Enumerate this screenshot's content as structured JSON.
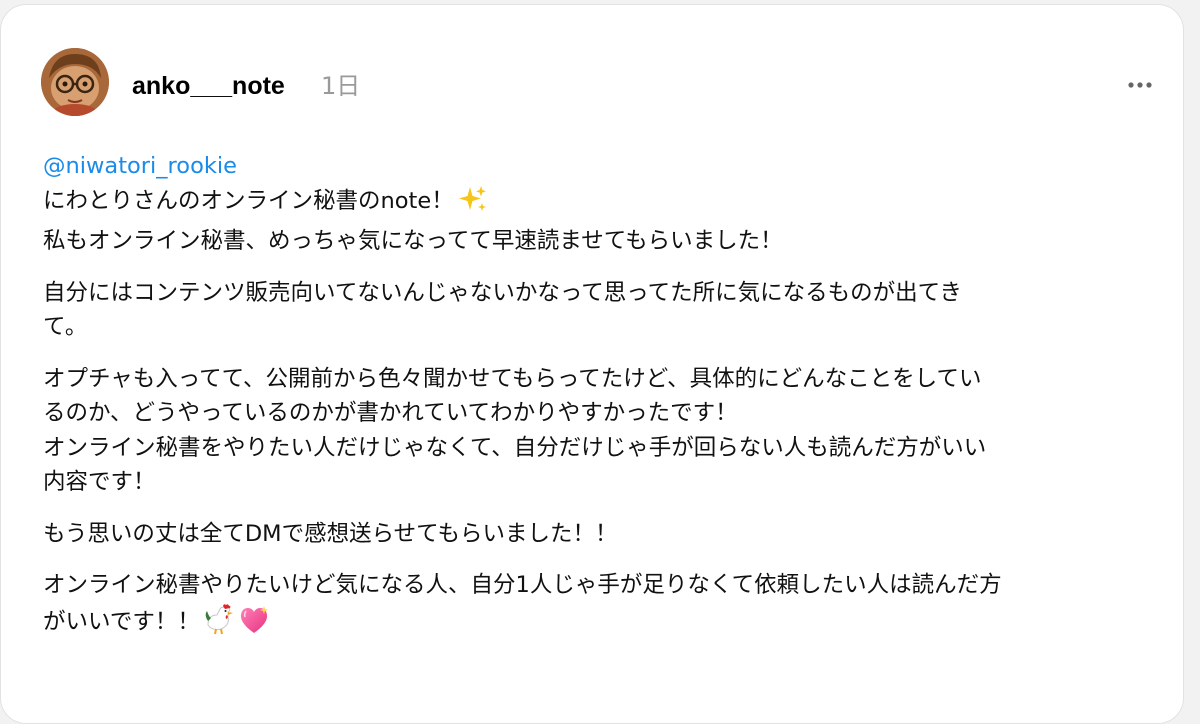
{
  "post": {
    "author": "anko___note",
    "time": "1日",
    "mention": "@niwatori_rookie",
    "lines": {
      "l1": "にわとりさんのオンライン秘書のnote！",
      "l2": "私もオンライン秘書、めっちゃ気になってて早速読ませてもらいました！",
      "p2a": "自分にはコンテンツ販売向いてないんじゃないかなって思ってた所に気になるものが出てき",
      "p2b": "て。",
      "p3a": "オプチャも入ってて、公開前から色々聞かせてもらってたけど、具体的にどんなことをしてい",
      "p3b": "るのか、どうやっているのかが書かれていてわかりやすかったです！",
      "p3c": "オンライン秘書をやりたい人だけじゃなくて、自分だけじゃ手が回らない人も読んだ方がいい",
      "p3d": "内容です！",
      "p4": "もう思いの丈は全てDMで感想送らせてもらいました！！",
      "p5a": "オンライン秘書やりたいけど気になる人、自分1人じゃ手が足りなくて依頼したい人は読んだ方",
      "p5b": "がいいです！！"
    },
    "icons": {
      "sparkles": "sparkles-icon",
      "rooster": "rooster-icon",
      "heart": "sparkling-heart-icon",
      "more": "more-options-icon",
      "avatar": "avatar"
    },
    "colors": {
      "mention": "#1a8be8",
      "text": "#111111",
      "timestamp": "#9a9a9a"
    }
  }
}
